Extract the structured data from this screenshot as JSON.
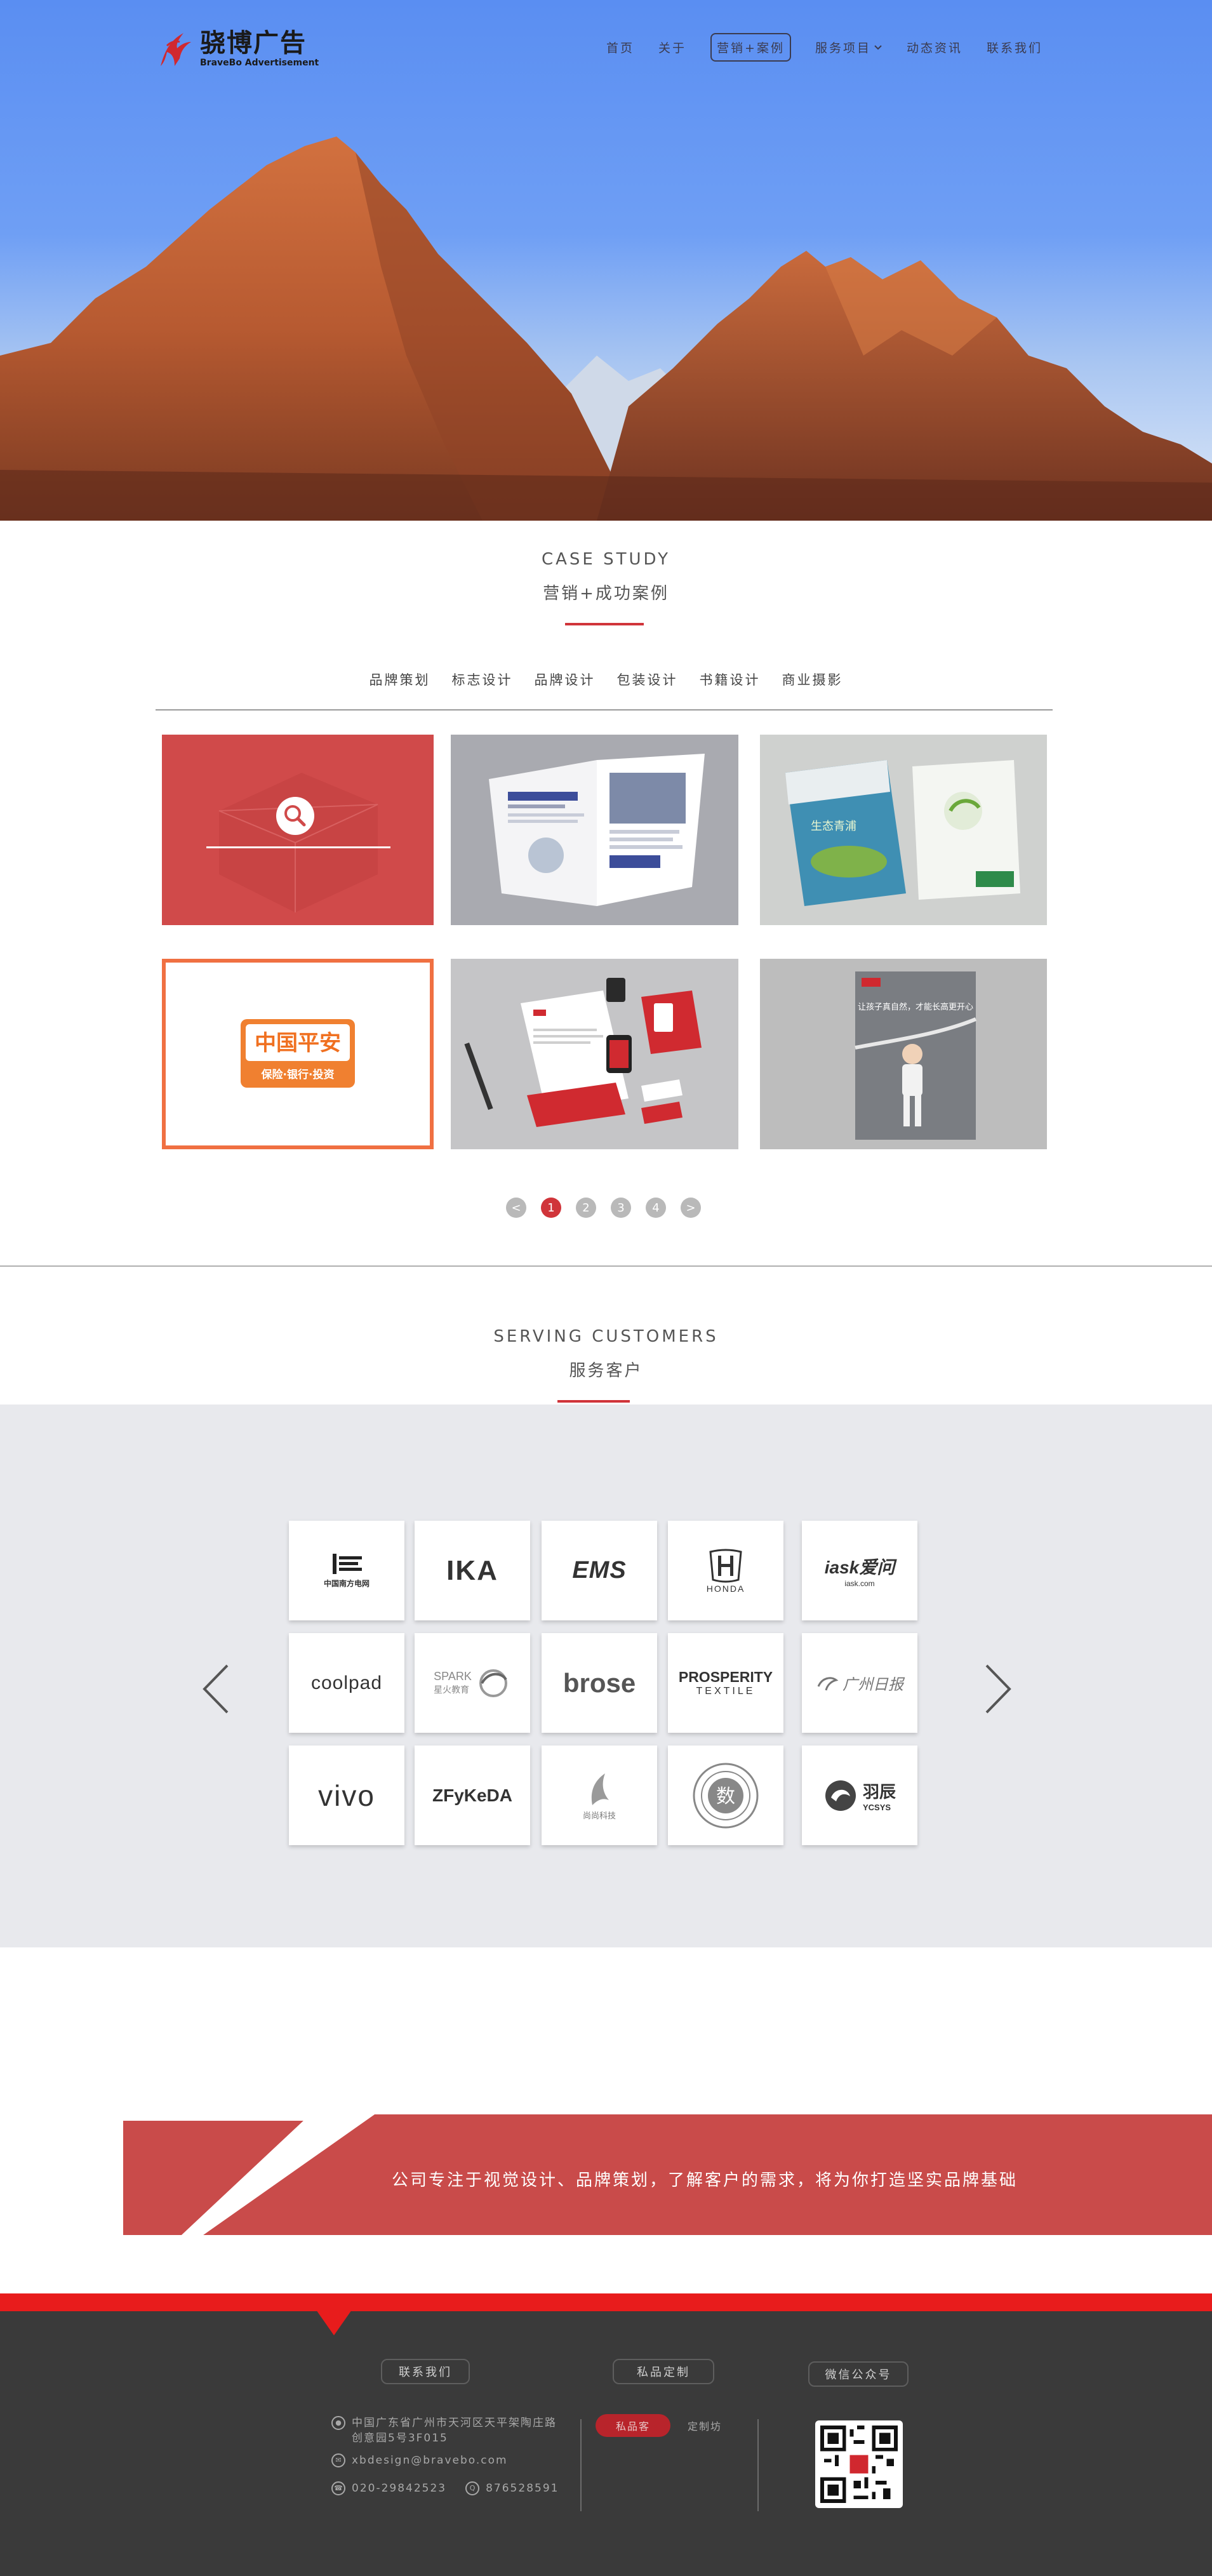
{
  "brand": {
    "name_cn": "骁博广告",
    "name_en": "BraveBo Advertisement"
  },
  "nav": {
    "items": [
      {
        "label": "首页"
      },
      {
        "label": "关于"
      },
      {
        "label": "营销+案例"
      },
      {
        "label": "服务项目"
      },
      {
        "label": "动态资讯"
      },
      {
        "label": "联系我们"
      }
    ],
    "active_index": 2
  },
  "case_study": {
    "title_en": "CASE STUDY",
    "title_cn": "营销+成功案例",
    "tabs": [
      "品牌策划",
      "标志设计",
      "品牌设计",
      "包装设计",
      "书籍设计",
      "商业摄影"
    ],
    "cards": [
      {
        "name": "search-overlay-card",
        "logo_text": ""
      },
      {
        "name": "brochure-card"
      },
      {
        "name": "booklet-card",
        "cover_text": "生态青浦"
      },
      {
        "name": "ping-an-card",
        "logo_text": "中国平安",
        "logo_sub": "保险·银行·投资"
      },
      {
        "name": "stationery-card"
      },
      {
        "name": "poster-card",
        "poster_text": "让孩子真自然，才能长高更开心"
      }
    ],
    "pager": {
      "prev": "<",
      "pages": [
        "1",
        "2",
        "3",
        "4"
      ],
      "next": ">",
      "current": "1"
    }
  },
  "customers": {
    "title_en": "SERVING CUSTOMERS",
    "title_cn": "服务客户",
    "logos": [
      {
        "text": "中国南方电网"
      },
      {
        "text": "IKA"
      },
      {
        "text": "EMS"
      },
      {
        "text": "HONDA"
      },
      {
        "text": "iask爱问",
        "sub": "iask.com"
      },
      {
        "text": "coolpad"
      },
      {
        "text": "SPARK",
        "sub": "星火教育"
      },
      {
        "text": "brose"
      },
      {
        "text": "PROSPERITY",
        "sub": "TEXTILE"
      },
      {
        "text": "广州日报"
      },
      {
        "text": "vivo"
      },
      {
        "text": "ZFyKeDA"
      },
      {
        "text": "尚尚科技"
      },
      {
        "text": "数"
      },
      {
        "text": "羽辰",
        "sub": "YCSYS"
      }
    ]
  },
  "banner": {
    "text": "公司专注于视觉设计、品牌策划，了解客户的需求，将为你打造坚实品牌基础"
  },
  "footer": {
    "contact_label": "联系我们",
    "address": "中国广东省广州市天河区天平架陶庄路创意园5号3F015",
    "email": "xbdesign@bravebo.com",
    "phone": "020-29842523",
    "qq": "876528591",
    "custom_label": "私品定制",
    "pill_active": "私品客",
    "pill_other": "定制坊",
    "wechat_label": "微信公众号"
  },
  "colors": {
    "accent": "#d0343a",
    "footer_bg": "#3a3a3a",
    "footer_red": "#e81c1c",
    "clients_bg": "#e8e9ed"
  }
}
